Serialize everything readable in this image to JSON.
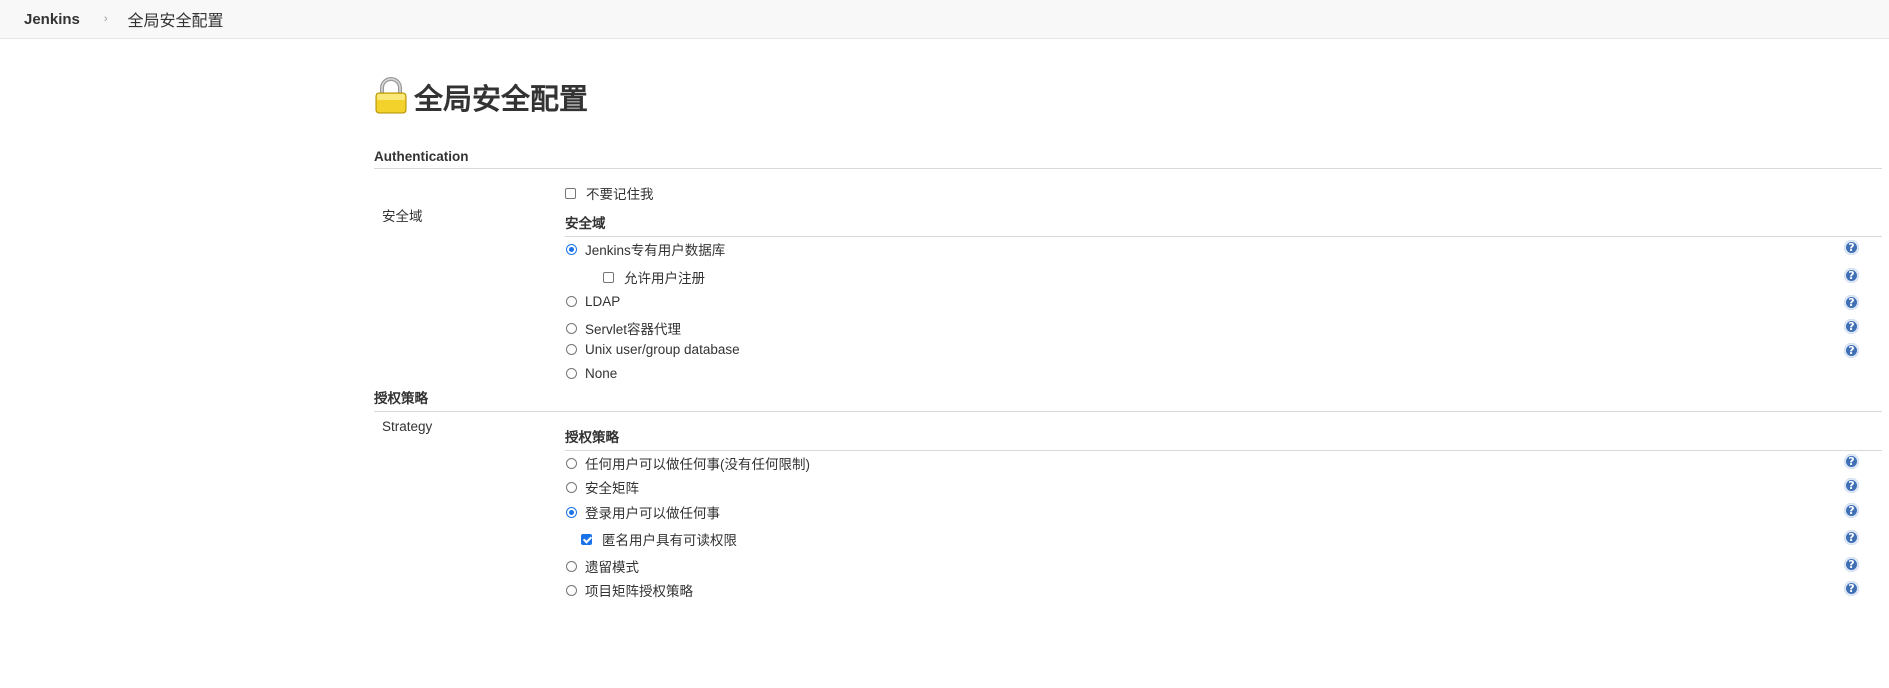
{
  "breadcrumb": {
    "home": "Jenkins",
    "separator": "›",
    "current": "全局安全配置"
  },
  "page": {
    "title": "全局安全配置",
    "icon": "lock-icon"
  },
  "authentication": {
    "header": "Authentication",
    "remember_me_label": "不要记住我",
    "remember_me_checked": false,
    "realm_label": "安全域",
    "realm_subheader": "安全域",
    "realm_options": [
      {
        "label": "Jenkins专有用户数据库",
        "selected": true
      },
      {
        "label": "LDAP",
        "selected": false
      },
      {
        "label": "Servlet容器代理",
        "selected": false
      },
      {
        "label": "Unix user/group database",
        "selected": false
      },
      {
        "label": "None",
        "selected": false
      }
    ],
    "allow_signup_label": "允许用户注册",
    "allow_signup_checked": false
  },
  "authorization": {
    "header": "授权策略",
    "row_label": "Strategy",
    "subheader": "授权策略",
    "options": [
      {
        "label": "任何用户可以做任何事(没有任何限制)",
        "selected": false
      },
      {
        "label": "安全矩阵",
        "selected": false
      },
      {
        "label": "登录用户可以做任何事",
        "selected": true
      },
      {
        "label": "遗留模式",
        "selected": false
      },
      {
        "label": "项目矩阵授权策略",
        "selected": false
      }
    ],
    "anonymous_read_label": "匿名用户具有可读权限",
    "anonymous_read_checked": true
  },
  "help_glyph": "?",
  "colors": {
    "accent": "#1a73e8",
    "help": "#3f6fb5",
    "lock_body": "#f2d22b"
  }
}
